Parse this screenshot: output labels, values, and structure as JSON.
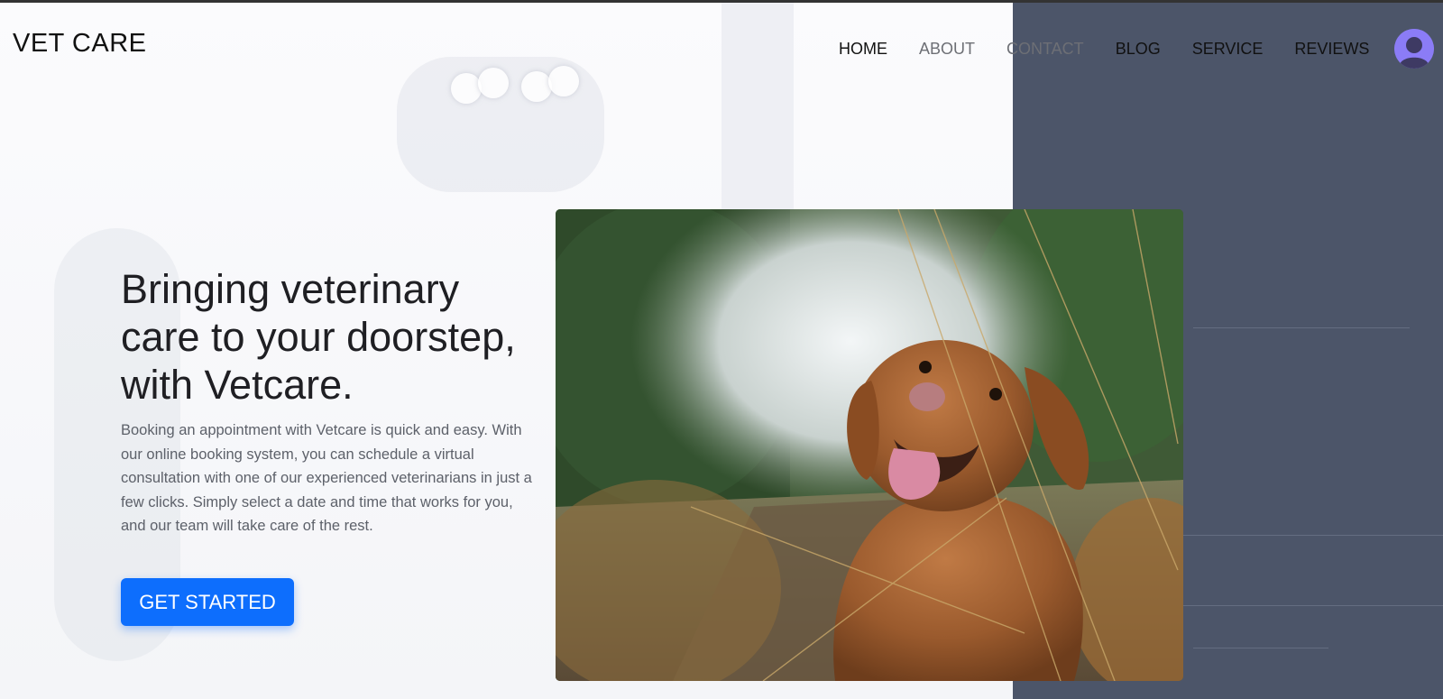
{
  "brand": {
    "name": "VET CARE"
  },
  "nav": {
    "items": [
      {
        "label": "HOME"
      },
      {
        "label": "ABOUT"
      },
      {
        "label": "CONTACT"
      },
      {
        "label": "BLOG"
      },
      {
        "label": "SERVICE"
      },
      {
        "label": "REVIEWS"
      }
    ],
    "avatar_icon": "user-avatar-icon"
  },
  "hero": {
    "title": "Bringing veterinary care to your doorstep, with Vetcare.",
    "description": "Booking an appointment with Vetcare is quick and easy. With our online booking system, you can schedule a virtual consultation with one of our experienced veterinarians in just a few clicks. Simply select a date and time that works for you, and our team will take care of the rest.",
    "cta_label": "GET STARTED",
    "image_subject": "dog-photo"
  },
  "colors": {
    "accent": "#0d6efd",
    "right_panel": "#4c5569",
    "avatar": "#8b7cf6"
  }
}
